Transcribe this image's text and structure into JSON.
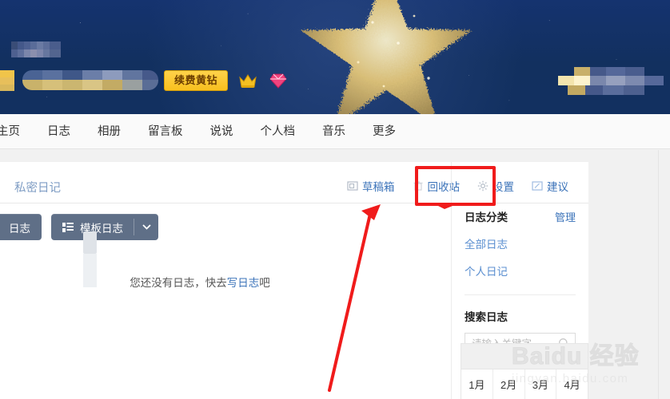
{
  "banner": {
    "renew_button_label": "续费黄钻",
    "crown_icon": "crown-icon",
    "gem_icon": "gem-icon",
    "star_graphic": "glitter-star-graphic",
    "masked_regions": [
      "username-mosaic",
      "profile-bar-mosaic",
      "right-mosaic"
    ]
  },
  "nav": {
    "items": [
      {
        "label": "主页"
      },
      {
        "label": "日志"
      },
      {
        "label": "相册"
      },
      {
        "label": "留言板"
      },
      {
        "label": "说说"
      },
      {
        "label": "个人档"
      },
      {
        "label": "音乐"
      },
      {
        "label": "更多"
      }
    ]
  },
  "panel": {
    "title": "私密日记",
    "tools": [
      {
        "label": "草稿箱",
        "icon": "draft-box-icon"
      },
      {
        "label": "回收站",
        "icon": "trash-icon"
      },
      {
        "label": "设置",
        "icon": "gear-icon"
      },
      {
        "label": "建议",
        "icon": "feedback-pencil-icon"
      }
    ],
    "highlighted_tool": "回收站",
    "highlight_color": "#f01b1b",
    "arrow_color": "#f01b1b"
  },
  "actions": {
    "write_button_label": "日志",
    "write_button_icon": "write-pencil-icon",
    "template_button_label": "模板日志",
    "template_button_icon": "template-grid-icon",
    "template_caret_icon": "chevron-down-icon",
    "button_color": "#5f6f87"
  },
  "empty_state": {
    "text_before": "您还没有日志，快去",
    "link_text": "写日志",
    "text_after": "吧"
  },
  "sidebar": {
    "category_title": "日志分类",
    "manage_label": "管理",
    "categories": [
      {
        "label": "全部日志"
      },
      {
        "label": "个人日记"
      }
    ],
    "search_title": "搜索日志",
    "search_placeholder": "请输入关键字",
    "search_value": "",
    "search_icon": "search-icon",
    "months": [
      "1月",
      "2月",
      "3月",
      "4月"
    ]
  },
  "watermark": {
    "main": "Baidu 经验",
    "sub": "jingyan.baidu.com"
  }
}
